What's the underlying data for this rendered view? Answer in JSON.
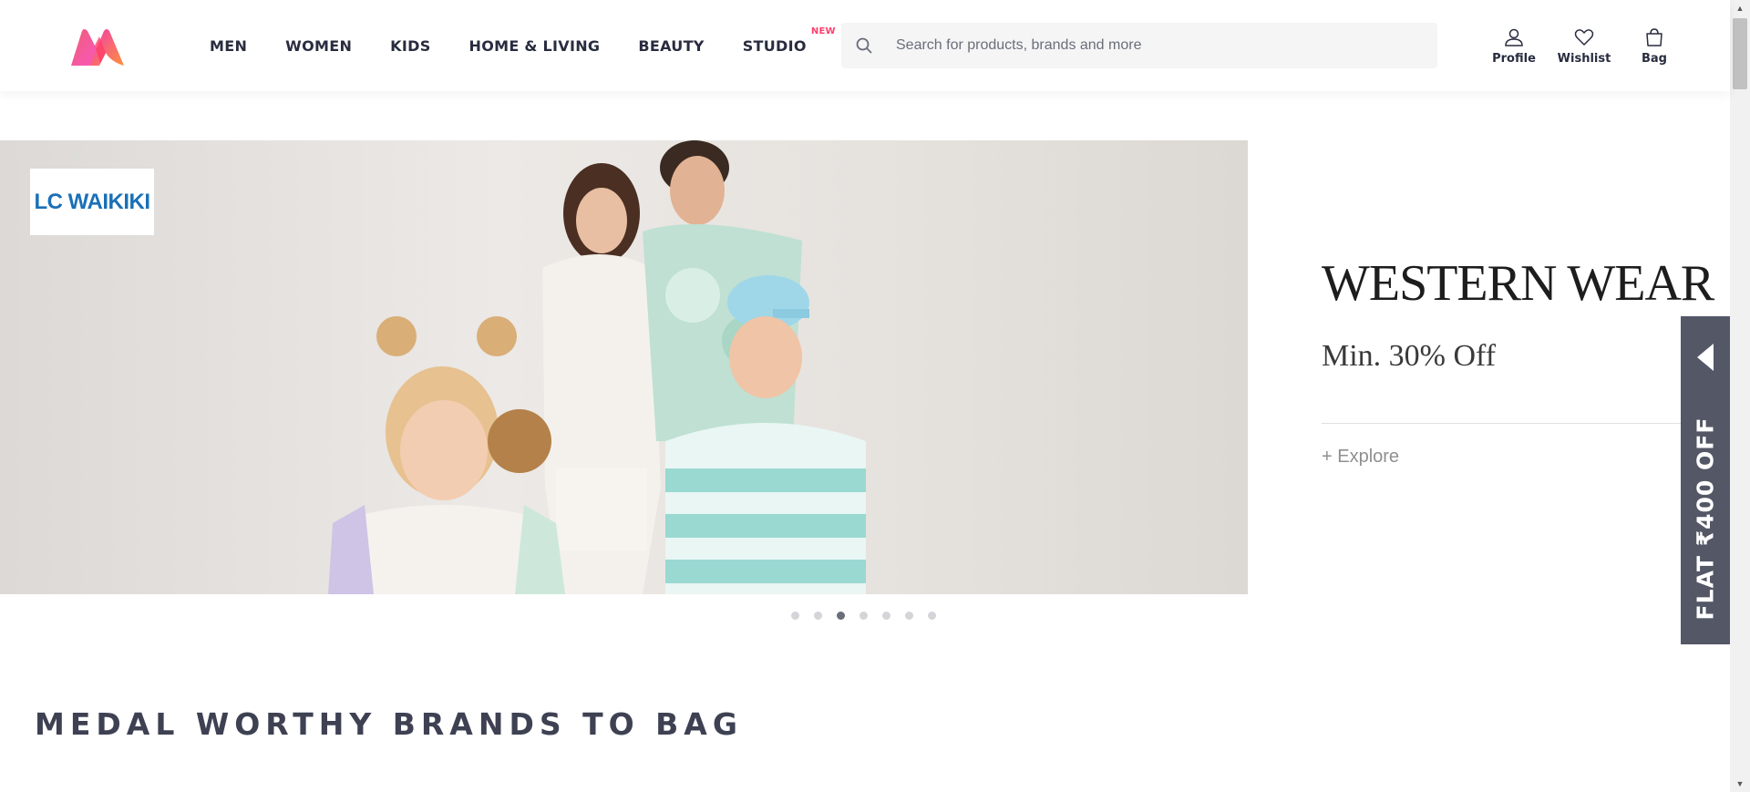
{
  "header": {
    "nav": [
      {
        "label": "MEN"
      },
      {
        "label": "WOMEN"
      },
      {
        "label": "KIDS"
      },
      {
        "label": "HOME & LIVING"
      },
      {
        "label": "BEAUTY"
      },
      {
        "label": "STUDIO",
        "badge": "NEW"
      }
    ],
    "search": {
      "placeholder": "Search for products, brands and more",
      "icon": "search-icon"
    },
    "actions": [
      {
        "label": "Profile",
        "icon": "profile-icon"
      },
      {
        "label": "Wishlist",
        "icon": "heart-icon"
      },
      {
        "label": "Bag",
        "icon": "bag-icon"
      }
    ]
  },
  "banner": {
    "brand": "LC WAIKIKI",
    "title": "WESTERN WEAR",
    "subtitle": "Min. 30% Off",
    "cta": "+ Explore",
    "slide_count": 7,
    "active_slide": 3
  },
  "offer_tab": {
    "label": "FLAT ₹400 OFF"
  },
  "section": {
    "title": "MEDAL WORTHY BRANDS TO BAG"
  },
  "colors": {
    "accent": "#ff3f6c",
    "text": "#282c3f",
    "offer_bg": "#535766",
    "brand_blue": "#1a70b7"
  }
}
